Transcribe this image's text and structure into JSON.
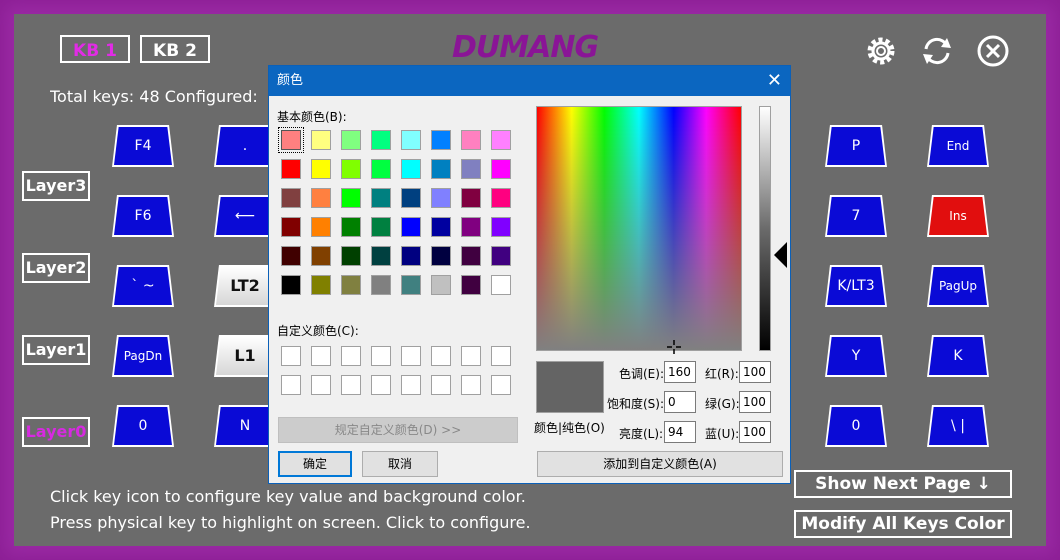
{
  "header": {
    "kb_buttons": [
      "KB 1",
      "KB 2"
    ],
    "logo": "DUMANG",
    "icons": [
      "gear-icon",
      "refresh-icon",
      "close-icon"
    ],
    "total_keys": "Total keys: 48 Configured:"
  },
  "layers": [
    "Layer3",
    "Layer2",
    "Layer1",
    "Layer0"
  ],
  "keys_left": [
    [
      "F4",
      "."
    ],
    [
      "F6",
      "⟵"
    ],
    [
      "` ~",
      "LT2"
    ],
    [
      "PagDn",
      "L1"
    ],
    [
      "0",
      "N"
    ]
  ],
  "keys_right": [
    [
      "P",
      "End"
    ],
    [
      "7",
      "Ins"
    ],
    [
      "K/LT3",
      "PagUp"
    ],
    [
      "Y",
      "K"
    ],
    [
      "0",
      "\\ |"
    ]
  ],
  "help": {
    "line1": "Click key icon to configure key value and background color.",
    "line2": "Press physical key to highlight on screen. Click to configure."
  },
  "buttons": {
    "next_page": "Show Next Page ↓",
    "modify_all": "Modify All Keys Color"
  },
  "dialog": {
    "title": "颜色",
    "basic_colors_label": "基本颜色(B):",
    "custom_colors_label": "自定义颜色(C):",
    "define_custom": "规定自定义颜色(D) >>",
    "ok": "确定",
    "cancel": "取消",
    "add_custom": "添加到自定义颜色(A)",
    "preview_label": "颜色|纯色(O)",
    "hue_label": "色调(E):",
    "sat_label": "饱和度(S):",
    "lum_label": "亮度(L):",
    "red_label": "红(R):",
    "green_label": "绿(G):",
    "blue_label": "蓝(U):",
    "hue": "160",
    "sat": "0",
    "lum": "94",
    "red": "100",
    "green": "100",
    "blue": "100",
    "basic_colors": [
      [
        "#ff8080",
        "#ffff80",
        "#80ff80",
        "#00ff80",
        "#80ffff",
        "#0080ff",
        "#ff80c0",
        "#ff80ff"
      ],
      [
        "#ff0000",
        "#ffff00",
        "#80ff00",
        "#00ff40",
        "#00ffff",
        "#0080c0",
        "#8080c0",
        "#ff00ff"
      ],
      [
        "#804040",
        "#ff8040",
        "#00ff00",
        "#008080",
        "#004080",
        "#8080ff",
        "#800040",
        "#ff0080"
      ],
      [
        "#800000",
        "#ff8000",
        "#008000",
        "#008040",
        "#0000ff",
        "#0000a0",
        "#800080",
        "#8000ff"
      ],
      [
        "#400000",
        "#804000",
        "#004000",
        "#004040",
        "#000080",
        "#000040",
        "#400040",
        "#400080"
      ],
      [
        "#000000",
        "#808000",
        "#808040",
        "#808080",
        "#408080",
        "#c0c0c0",
        "#400040",
        "#ffffff"
      ]
    ]
  }
}
